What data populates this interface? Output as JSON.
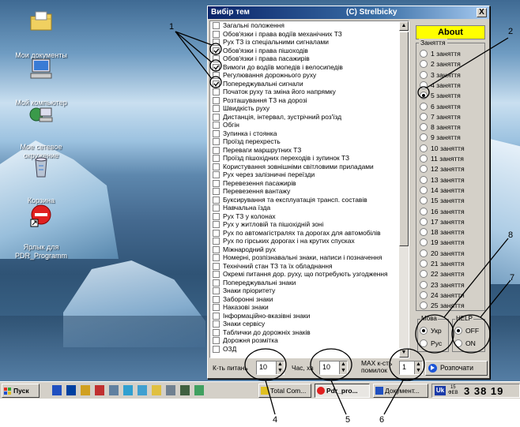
{
  "desktop": {
    "icons": [
      {
        "label": "Мои документы",
        "name": "folder-icon"
      },
      {
        "label": "Мой компьютер",
        "name": "computer-icon"
      },
      {
        "label": "Мое сетевое окружение",
        "name": "network-icon"
      },
      {
        "label": "Корзина",
        "name": "recycle-bin-icon"
      },
      {
        "label": "Ярлык для PDR_Programm",
        "name": "shortcut-icon"
      }
    ]
  },
  "window": {
    "title": "Вибір тем",
    "copyright": "(C) Strelbicky",
    "close_glyph": "X",
    "topics": [
      "Загальні положення",
      "Обов'язки і права водіїв механічних ТЗ",
      "Рух ТЗ із спеціальними сигналами",
      "Обов'язки і права пішоходів",
      "Обов'язки і права пасажирів",
      "Вимоги до водіїв мопедів і велосипедів",
      "Регулювання дорожнього руху",
      "Попереджувальні сигнали",
      "Початок руху та зміна його напрямку",
      "Розташування ТЗ на дорозі",
      "Швидкість руху",
      "Дистанція, інтервал, зустрічний роз'їзд",
      "Обгін",
      "Зупинка і стоянка",
      "Проїзд перехресть",
      "Переваги маршрутних ТЗ",
      "Проїзд пішохідних переходів і зупинок ТЗ",
      "Користування зовнішніми світловими приладами",
      "Рух через залізничні переїзди",
      "Перевезення пасажирів",
      "Перевезення вантажу",
      "Буксирування та експлуатація трансп. составів",
      "Навчальна їзда",
      "Рух ТЗ у колонах",
      "Рух у житловій та пішохідній зоні",
      "Рух по автомагістралях та дорогах для автомобілів",
      "Рух по гірських дорогах і на крутих спусках",
      "Міжнародний рух",
      "Номерні, розпізнавальні знаки, написи і позначення",
      "Технічний стан ТЗ та їх обладнання",
      "Окремі питання дор. руху, що потребують узгодження",
      "Попереджувальні знаки",
      "Знаки пріоритету",
      "Заборонні знаки",
      "Наказові знаки",
      "Інформаційно-вказівні знаки",
      "Знаки сервісу",
      "Таблички до дорожніх знаків",
      "Дорожня розмітка",
      "ОЗД"
    ],
    "checked_topic_indices": [
      3,
      5,
      7
    ],
    "about_label": "About",
    "lessons_caption": "Заняття",
    "lessons": [
      "1 заняття",
      "2 заняття",
      "3 заняття",
      "4 заняття",
      "5 заняття",
      "6 заняття",
      "7 заняття",
      "8 заняття",
      "9 заняття",
      "10 заняття",
      "11 заняття",
      "12 заняття",
      "13 заняття",
      "14 заняття",
      "15 заняття",
      "16 заняття",
      "17 заняття",
      "18 заняття",
      "19 заняття",
      "20 заняття",
      "21 заняття",
      "22 заняття",
      "23 заняття",
      "24 заняття",
      "25 заняття"
    ],
    "selected_lesson_index": 4,
    "lang_group": {
      "caption": "Мова",
      "options": [
        "Укр",
        "Рус"
      ],
      "selected": 0
    },
    "help_group": {
      "caption": "HELP",
      "options": [
        "OFF",
        "ON"
      ],
      "selected": 0
    },
    "bottom": {
      "count_label": "К-ть питань",
      "count_value": "10",
      "time_label": "Час, хв",
      "time_value": "10",
      "max_errors_label_1": "MAX к-сть",
      "max_errors_label_2": "помилок",
      "max_errors_value": "1",
      "start_label": "Розпочати"
    }
  },
  "taskbar": {
    "start_label": "Пуск",
    "tasks": [
      "Total Com...",
      "Pdr_pro...",
      "Документ..."
    ],
    "active_task_index": 1,
    "lang_indicator": "Uk",
    "date_top": "15",
    "date_bottom": "ФЕВ",
    "clock": "3 38 19"
  },
  "annotations": [
    "1",
    "2",
    "4",
    "5",
    "6",
    "7",
    "8"
  ]
}
